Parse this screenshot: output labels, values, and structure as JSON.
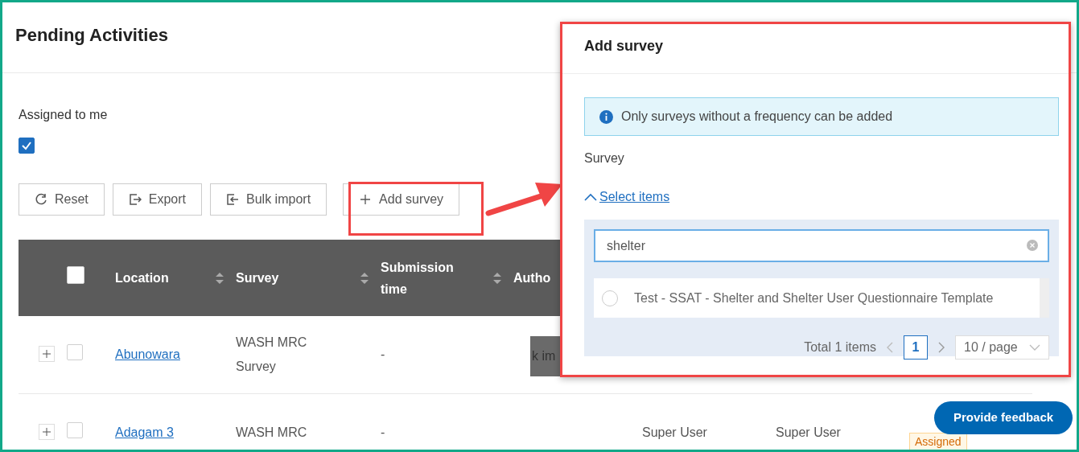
{
  "page": {
    "title": "Pending Activities"
  },
  "filter": {
    "label": "Assigned to me",
    "checked": true
  },
  "toolbar": [
    {
      "label": "Reset"
    },
    {
      "label": "Export"
    },
    {
      "label": "Bulk import"
    },
    {
      "label": "Add survey"
    }
  ],
  "table": {
    "select_all_checked": false,
    "columns": [
      {
        "label": "Location",
        "sortable": true
      },
      {
        "label": "Survey",
        "sortable": true
      },
      {
        "label": "Submission time",
        "sortable": true
      },
      {
        "label": "Autho",
        "sortable": false
      }
    ],
    "rows": [
      {
        "expanded": false,
        "checked": false,
        "location": "Abunowara",
        "survey": "WASH MRC Survey",
        "submission_time": "-"
      },
      {
        "expanded": false,
        "checked": false,
        "location": "Adagam 3",
        "survey": "WASH MRC",
        "submission_time": "-",
        "column_6": "Super User",
        "column_7": "Super User",
        "status": "Assigned"
      }
    ]
  },
  "tooltip": {
    "text": "k im"
  },
  "panel": {
    "title": "Add survey",
    "info": "Only surveys without a frequency can be added",
    "field_label": "Survey",
    "toggle": {
      "label": "Select items",
      "expanded": true
    },
    "search": {
      "value": "shelter"
    },
    "options": [
      {
        "label": "Test - SSAT - Shelter and Shelter User Questionnaire Template",
        "selected": false
      }
    ],
    "pagination": {
      "total": "Total 1 items",
      "pages": [
        {
          "label": "1",
          "selected": true
        }
      ],
      "page_size": "10 / page"
    }
  },
  "feedback_button": "Provide feedback"
}
